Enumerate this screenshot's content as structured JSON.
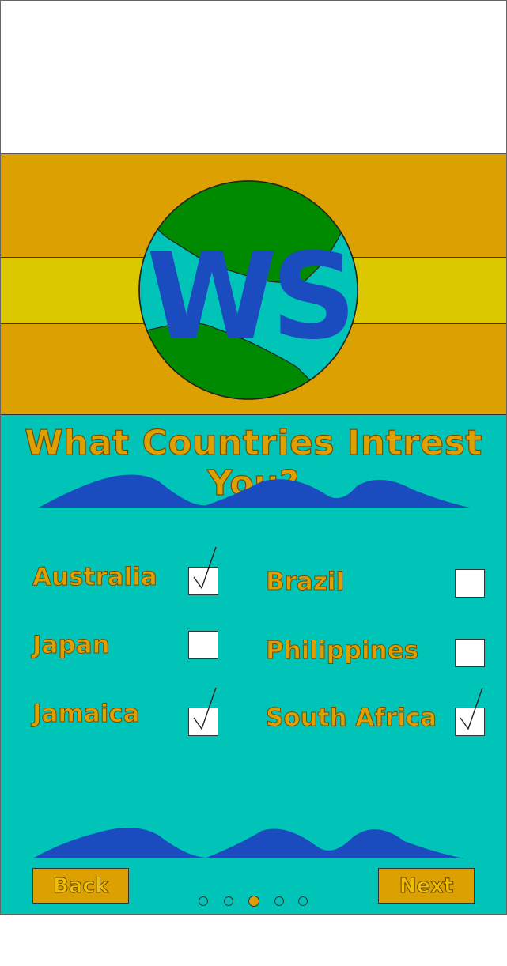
{
  "header": {
    "logo_text": "WS",
    "colors": {
      "band": "#dca000",
      "stripe": "#dcc800",
      "ocean": "#00c4b8",
      "land": "#008a00",
      "logo_text": "#1a4bbf"
    }
  },
  "main": {
    "title": "What Countries Intrest You?",
    "options": [
      {
        "label": "Australia",
        "checked": true
      },
      {
        "label": "Brazil",
        "checked": false
      },
      {
        "label": "Japan",
        "checked": false
      },
      {
        "label": "Philippines",
        "checked": false
      },
      {
        "label": "Jamaica",
        "checked": true
      },
      {
        "label": "South Africa",
        "checked": true
      }
    ]
  },
  "footer": {
    "back_label": "Back",
    "next_label": "Next",
    "page_count": 5,
    "current_page": 3
  },
  "colors": {
    "accent": "#dca000",
    "background": "#00c4b8",
    "wave": "#1a4bbf"
  }
}
